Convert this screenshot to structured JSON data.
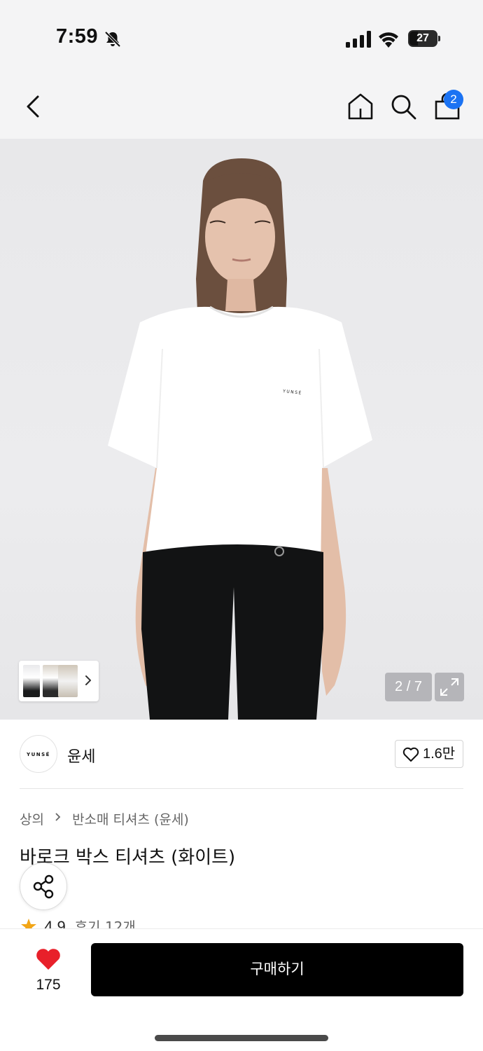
{
  "status_bar": {
    "time": "7:59",
    "battery_level": "27"
  },
  "header": {
    "cart_count": "2"
  },
  "gallery": {
    "counter": "2 / 7",
    "shirt_logo_text": "YUNSÉ"
  },
  "brand": {
    "logo_text": "YUNSÉ",
    "name": "윤세",
    "like_count": "1.6만"
  },
  "product": {
    "breadcrumb": [
      "상의",
      "반소매 티셔츠 (윤세)"
    ],
    "title": "바로크 박스 티셔츠 (화이트)",
    "rating": "4.9",
    "review_label": "후기 12개"
  },
  "bottom_bar": {
    "wish_count": "175",
    "buy_label": "구매하기"
  },
  "colors": {
    "accent_badge": "#1b73f3",
    "wish_heart": "#e8202a",
    "star": "#f2a516",
    "buy_button": "#000000"
  },
  "icons": [
    "bell-slash-icon",
    "signal-icon",
    "wifi-icon",
    "battery-icon",
    "chevron-left-icon",
    "home-icon",
    "search-icon",
    "shopping-bag-icon",
    "chevron-right-icon",
    "expand-icon",
    "heart-outline-icon",
    "share-icon",
    "star-icon",
    "heart-filled-icon"
  ]
}
